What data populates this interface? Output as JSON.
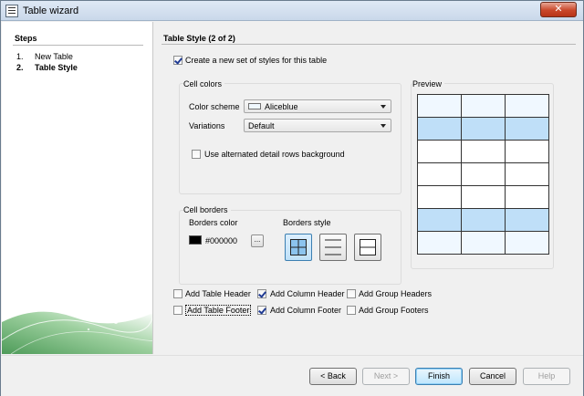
{
  "window": {
    "title": "Table wizard",
    "close_glyph": "✕"
  },
  "steps": {
    "title": "Steps",
    "items": [
      {
        "num": "1.",
        "label": "New Table",
        "active": false
      },
      {
        "num": "2.",
        "label": "Table Style",
        "active": true
      }
    ]
  },
  "page": {
    "title": "Table Style (2 of 2)",
    "create_styles": {
      "label": "Create a new set of styles for this table",
      "checked": true
    },
    "cell_colors": {
      "title": "Cell colors",
      "color_scheme_label": "Color scheme",
      "color_scheme_value": "Aliceblue",
      "color_scheme_swatch": "#f0f8ff",
      "variations_label": "Variations",
      "variations_value": "Default",
      "alternated_rows": {
        "label": "Use alternated detail rows background",
        "checked": false
      }
    },
    "cell_borders": {
      "title": "Cell borders",
      "borders_color_label": "Borders color",
      "borders_color_value": "#000000",
      "ellipsis_label": "...",
      "borders_style_label": "Borders style"
    },
    "preview": {
      "title": "Preview",
      "row_colors": [
        "#f0f8ff",
        "#bfdff8",
        "#ffffff",
        "#ffffff",
        "#ffffff",
        "#bfdff8",
        "#f0f8ff"
      ]
    },
    "options": [
      {
        "label": "Add Table Header",
        "checked": false
      },
      {
        "label": "Add Column Header",
        "checked": true
      },
      {
        "label": "Add Group Headers",
        "checked": false
      },
      {
        "label": "Add Table Footer",
        "checked": false
      },
      {
        "label": "Add Column Footer",
        "checked": true
      },
      {
        "label": "Add Group Footers",
        "checked": false
      }
    ]
  },
  "buttons": {
    "back": "< Back",
    "next": "Next >",
    "finish": "Finish",
    "cancel": "Cancel",
    "help": "Help"
  }
}
